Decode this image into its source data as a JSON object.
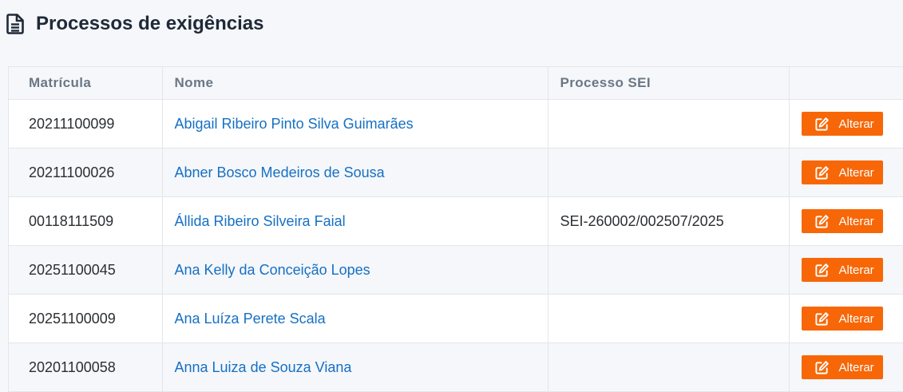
{
  "page": {
    "title": "Processos de exigências",
    "icon": "file-text-icon"
  },
  "table": {
    "headers": [
      "Matrícula",
      "Nome",
      "Processo SEI",
      ""
    ],
    "rows": [
      {
        "matricula": "20211100099",
        "nome": "Abigail Ribeiro Pinto Silva Guimarães",
        "processo": "",
        "action": "Alterar"
      },
      {
        "matricula": "20211100026",
        "nome": "Abner Bosco Medeiros de Sousa",
        "processo": "",
        "action": "Alterar"
      },
      {
        "matricula": "00118111509",
        "nome": "Állida Ribeiro Silveira Faial",
        "processo": "SEI-260002/002507/2025",
        "action": "Alterar"
      },
      {
        "matricula": "20251100045",
        "nome": "Ana Kelly da Conceição Lopes",
        "processo": "",
        "action": "Alterar"
      },
      {
        "matricula": "20251100009",
        "nome": "Ana Luíza Perete Scala",
        "processo": "",
        "action": "Alterar"
      },
      {
        "matricula": "20201100058",
        "nome": "Anna Luiza de Souza Viana",
        "processo": "",
        "action": "Alterar"
      }
    ]
  },
  "colors": {
    "accent": "#f76707",
    "link": "#1670c4",
    "stripe": "#f5f7fa"
  },
  "icons": {
    "action_icon": "edit-icon"
  }
}
